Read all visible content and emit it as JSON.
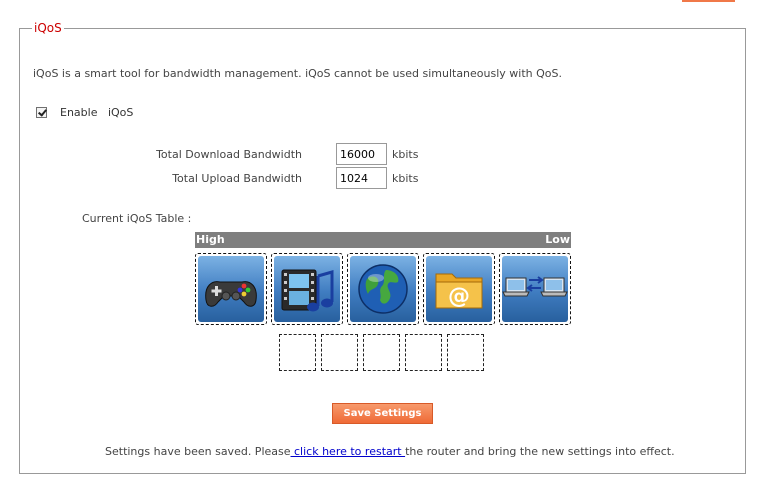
{
  "panel": {
    "title": "iQoS",
    "description": "iQoS is a smart tool for bandwidth management. iQoS cannot be used simultaneously with QoS."
  },
  "enable": {
    "checked": true,
    "label": "Enable   iQoS"
  },
  "bandwidth": {
    "download_label": "Total Download Bandwidth",
    "download_value": "16000",
    "upload_label": "Total Upload Bandwidth",
    "upload_value": "1024",
    "unit": "kbits"
  },
  "iqos_table": {
    "caption": "Current iQoS Table :",
    "high_label": "High",
    "low_label": "Low",
    "apps": [
      {
        "icon": "gamepad-icon"
      },
      {
        "icon": "video-music-icon"
      },
      {
        "icon": "globe-icon"
      },
      {
        "icon": "email-folder-icon"
      },
      {
        "icon": "file-transfer-icon"
      }
    ],
    "empty_slots": 5
  },
  "save_button": {
    "label": "Save Settings"
  },
  "status": {
    "prefix": "Settings have been saved. Please",
    "link": " click here to restart ",
    "suffix": "the router and bring the new settings into effect."
  },
  "colors": {
    "accent": "#ef6a36",
    "legend": "#cc0000",
    "link": "#0000cc",
    "priority_bar": "#7f7f7f"
  }
}
